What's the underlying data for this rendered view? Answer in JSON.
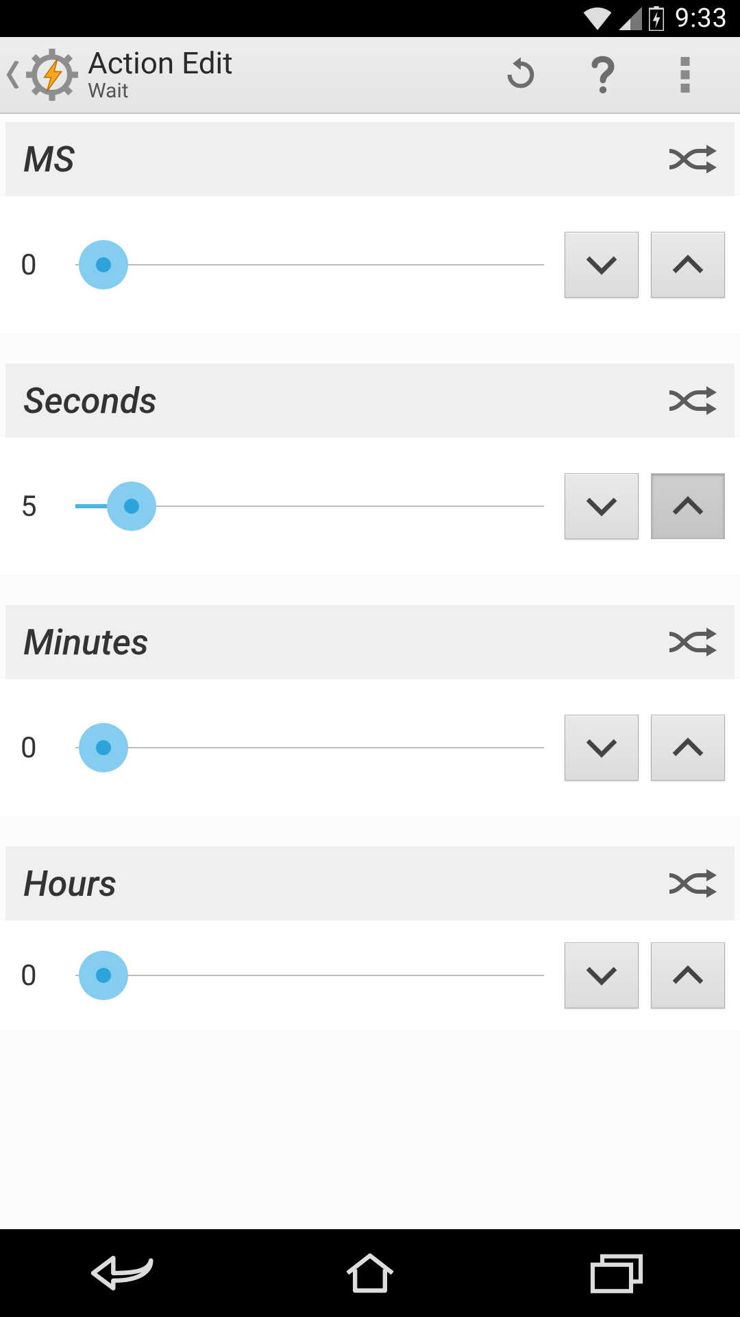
{
  "status": {
    "time": "9:33"
  },
  "actionbar": {
    "title": "Action Edit",
    "subtitle": "Wait"
  },
  "fields": [
    {
      "label": "MS",
      "value": "0",
      "slider_pct": 0
    },
    {
      "label": "Seconds",
      "value": "5",
      "slider_pct": 8,
      "up_pressed": true
    },
    {
      "label": "Minutes",
      "value": "0",
      "slider_pct": 0
    },
    {
      "label": "Hours",
      "value": "0",
      "slider_pct": 0
    }
  ],
  "colors": {
    "accent": "#47b3e6",
    "halo": "#84cdf0",
    "core": "#2da3de"
  }
}
